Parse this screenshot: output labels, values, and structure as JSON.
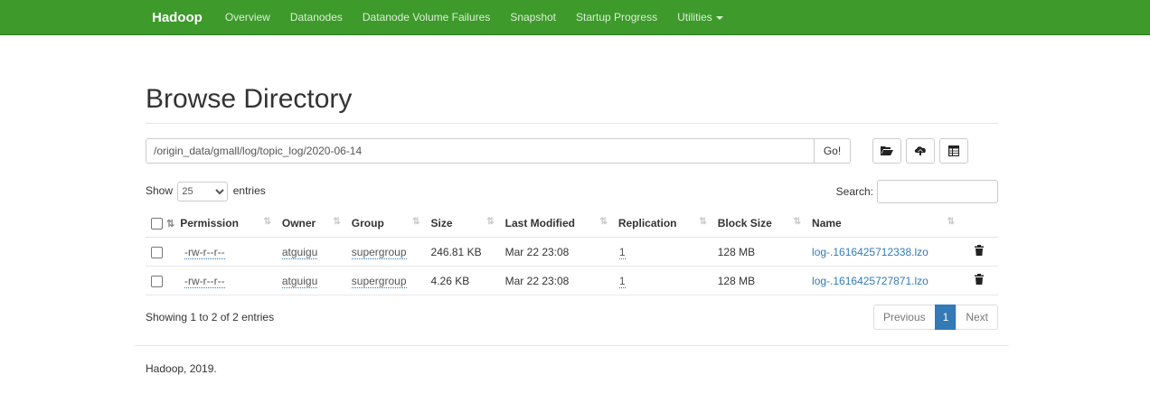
{
  "navbar": {
    "brand": "Hadoop",
    "items": [
      "Overview",
      "Datanodes",
      "Datanode Volume Failures",
      "Snapshot",
      "Startup Progress"
    ],
    "utilities": "Utilities",
    "color": "#3d9a2b"
  },
  "page": {
    "title": "Browse Directory"
  },
  "path_bar": {
    "value": "/origin_data/gmall/log/topic_log/2020-06-14",
    "go_label": "Go!",
    "tool_icons": [
      "folder-open-icon",
      "upload-cloud-icon",
      "table-icon"
    ]
  },
  "controls": {
    "show_label": "Show",
    "entries_label": "entries",
    "entries_value": "25",
    "search_label": "Search:"
  },
  "table": {
    "headers": [
      "Permission",
      "Owner",
      "Group",
      "Size",
      "Last Modified",
      "Replication",
      "Block Size",
      "Name"
    ],
    "rows": [
      {
        "permission": "-rw-r--r--",
        "owner": "atguigu",
        "group": "supergroup",
        "size": "246.81 KB",
        "modified": "Mar 22 23:08",
        "replication": "1",
        "block_size": "128 MB",
        "name": "log-.1616425712338.lzo"
      },
      {
        "permission": "-rw-r--r--",
        "owner": "atguigu",
        "group": "supergroup",
        "size": "4.26 KB",
        "modified": "Mar 22 23:08",
        "replication": "1",
        "block_size": "128 MB",
        "name": "log-.1616425727871.lzo"
      }
    ]
  },
  "summary": "Showing 1 to 2 of 2 entries",
  "pagination": {
    "previous": "Previous",
    "current": "1",
    "next": "Next"
  },
  "footer": "Hadoop, 2019."
}
